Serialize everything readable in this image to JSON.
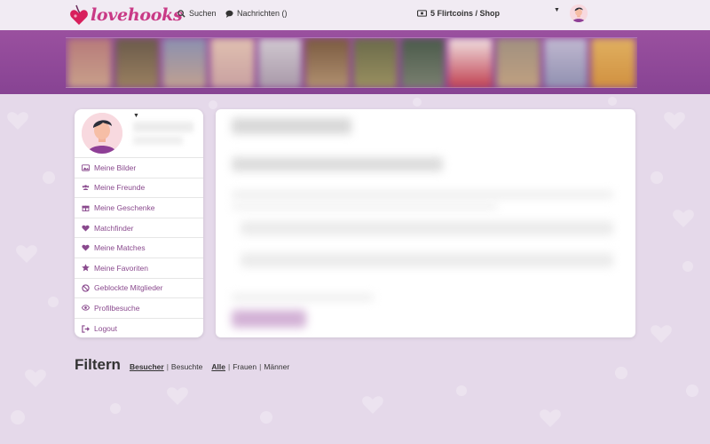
{
  "header": {
    "logo_text": "lovehooks",
    "search_label": "Suchen",
    "messages_label": "Nachrichten ()",
    "coins_label": "5 Flirtcoins / Shop"
  },
  "sidebar": {
    "items": [
      {
        "label": "Meine Bilder",
        "icon": "image-icon"
      },
      {
        "label": "Meine Freunde",
        "icon": "users-icon"
      },
      {
        "label": "Meine Geschenke",
        "icon": "gift-icon"
      },
      {
        "label": "Matchfinder",
        "icon": "heart-icon"
      },
      {
        "label": "Meine Matches",
        "icon": "heart-icon"
      },
      {
        "label": "Meine Favoriten",
        "icon": "star-icon"
      },
      {
        "label": "Geblockte Mitglieder",
        "icon": "ban-icon"
      },
      {
        "label": "Profilbesuche",
        "icon": "eye-icon"
      },
      {
        "label": "Logout",
        "icon": "logout-icon"
      }
    ]
  },
  "filter": {
    "title": "Filtern",
    "visit_options": [
      "Besucher",
      "Besuchte"
    ],
    "gender_options": [
      "Alle",
      "Frauen",
      "Männer"
    ],
    "active_visit": "Besucher",
    "active_gender": "Alle"
  },
  "colors": {
    "brand": "#c93a86",
    "banner": "#8f4898",
    "menu_text": "#8a4a8e",
    "background": "#e5d9ea"
  }
}
